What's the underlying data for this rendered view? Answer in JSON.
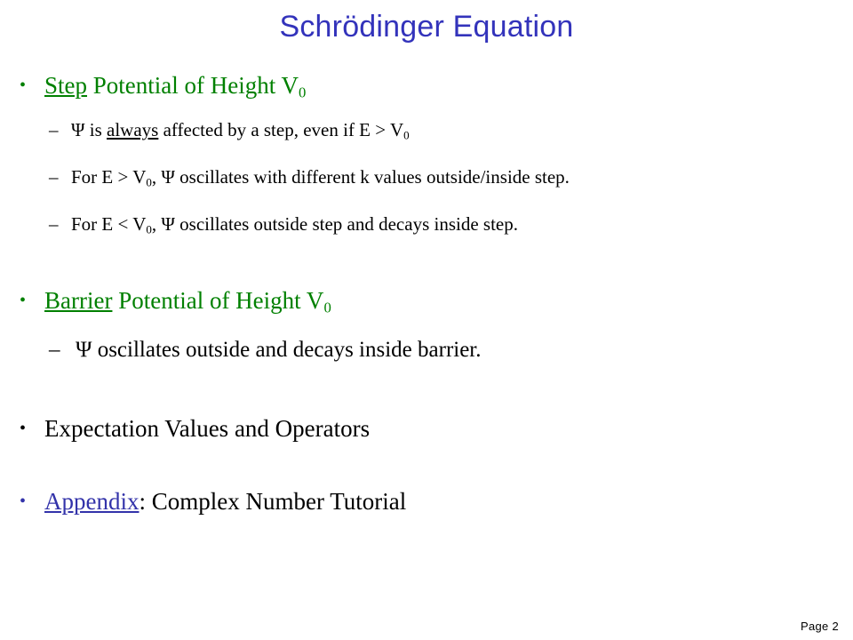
{
  "slide": {
    "title": "Schrödinger Equation",
    "title_color": "#3333bb",
    "background_color": "#ffffff",
    "page_number_label": "Page 2"
  },
  "colors": {
    "green": "#008000",
    "black": "#000000",
    "link_blue": "#3333aa",
    "title_blue": "#3333bb"
  },
  "bullets": {
    "b1": {
      "marker": "•",
      "underlined": "Step",
      "rest": " Potential of Height V",
      "subscript": "0"
    },
    "b1s1": {
      "marker": "–",
      "pre": "Ψ is ",
      "underlined": "always",
      "post": " affected by a step, even if E > V",
      "subscript": "0"
    },
    "b1s2": {
      "marker": "–",
      "pre": "For E > V",
      "subscript": "0",
      "post": ", Ψ oscillates with different k values outside/inside step."
    },
    "b1s3": {
      "marker": "–",
      "pre": "For E < V",
      "subscript": "0",
      "post": ", Ψ oscillates outside step and decays inside step."
    },
    "b2": {
      "marker": "•",
      "underlined": "Barrier",
      "rest": " Potential of Height V",
      "subscript": "0"
    },
    "b2s1": {
      "marker": "–",
      "text": "Ψ oscillates outside and decays inside barrier."
    },
    "b3": {
      "marker": "•",
      "text": "Expectation Values and Operators"
    },
    "b4": {
      "marker": "•",
      "underlined": "Appendix",
      "rest": ": Complex Number Tutorial"
    }
  }
}
